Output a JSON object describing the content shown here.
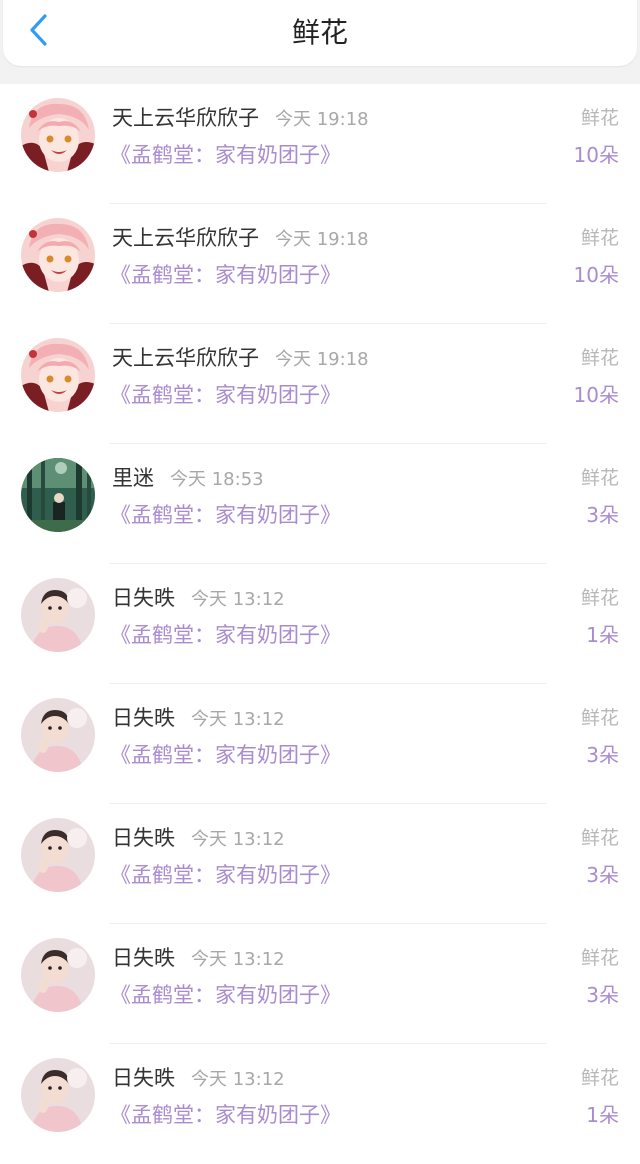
{
  "header": {
    "title": "鲜花",
    "back_icon": "chevron-left-icon",
    "accent_color": "#2e9df2"
  },
  "colors": {
    "accent_purple": "#a98bd0",
    "muted_gray": "#a8a8a8"
  },
  "items": [
    {
      "user": "天上云华欣欣子",
      "time": "今天 19:18",
      "book": "《孟鹤堂：家有奶团子》",
      "gift": "鲜花",
      "count": "10朵",
      "avatar": "anime-avatar"
    },
    {
      "user": "天上云华欣欣子",
      "time": "今天 19:18",
      "book": "《孟鹤堂：家有奶团子》",
      "gift": "鲜花",
      "count": "10朵",
      "avatar": "anime-avatar"
    },
    {
      "user": "天上云华欣欣子",
      "time": "今天 19:18",
      "book": "《孟鹤堂：家有奶团子》",
      "gift": "鲜花",
      "count": "10朵",
      "avatar": "anime-avatar"
    },
    {
      "user": "里迷",
      "time": "今天 18:53",
      "book": "《孟鹤堂：家有奶团子》",
      "gift": "鲜花",
      "count": "3朵",
      "avatar": "forest-avatar"
    },
    {
      "user": "日失昳",
      "time": "今天 13:12",
      "book": "《孟鹤堂：家有奶团子》",
      "gift": "鲜花",
      "count": "1朵",
      "avatar": "baby-avatar"
    },
    {
      "user": "日失昳",
      "time": "今天 13:12",
      "book": "《孟鹤堂：家有奶团子》",
      "gift": "鲜花",
      "count": "3朵",
      "avatar": "baby-avatar"
    },
    {
      "user": "日失昳",
      "time": "今天 13:12",
      "book": "《孟鹤堂：家有奶团子》",
      "gift": "鲜花",
      "count": "3朵",
      "avatar": "baby-avatar"
    },
    {
      "user": "日失昳",
      "time": "今天 13:12",
      "book": "《孟鹤堂：家有奶团子》",
      "gift": "鲜花",
      "count": "3朵",
      "avatar": "baby-avatar"
    },
    {
      "user": "日失昳",
      "time": "今天 13:12",
      "book": "《孟鹤堂：家有奶团子》",
      "gift": "鲜花",
      "count": "1朵",
      "avatar": "baby-avatar"
    }
  ]
}
